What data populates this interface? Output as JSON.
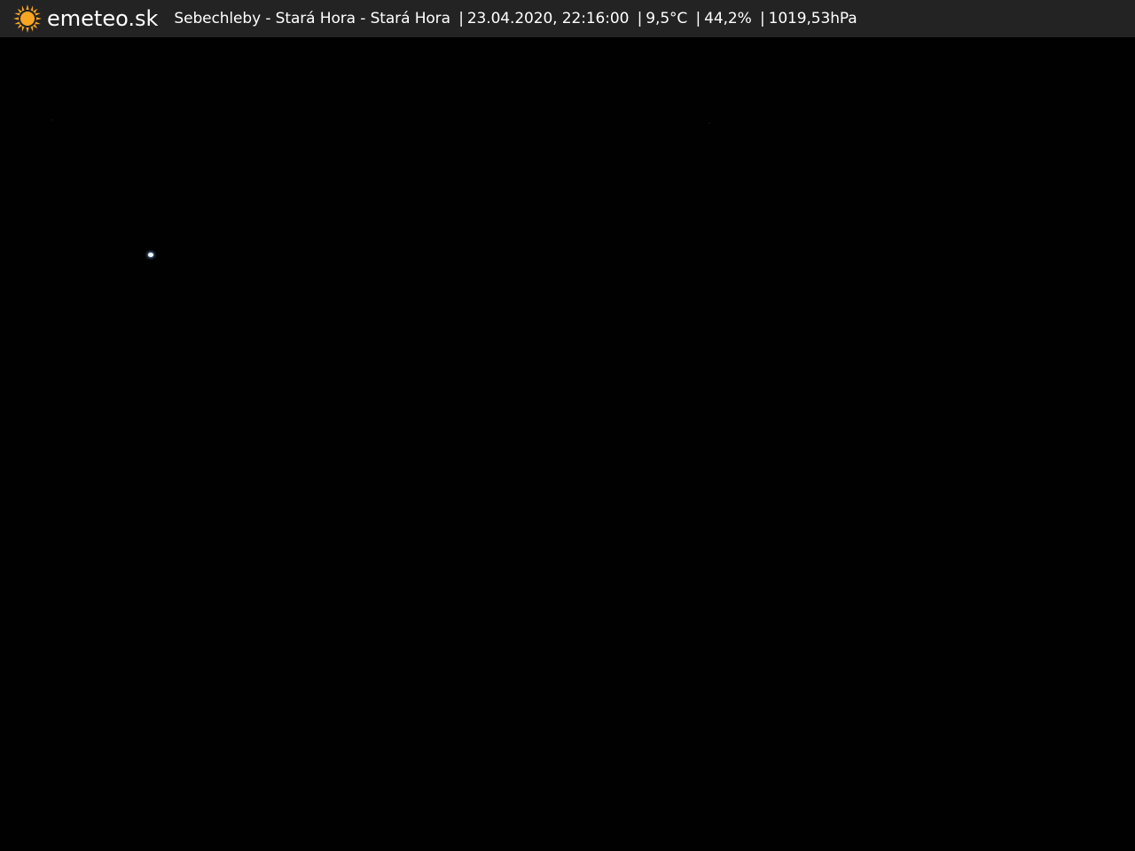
{
  "header": {
    "brand": "emeteo.sk",
    "logo_icon": "sun-icon",
    "location": "Sebechleby - Stará Hora - Stará Hora",
    "datetime": "23.04.2020, 22:16:00",
    "temperature": "9,5°C",
    "humidity": "44,2%",
    "pressure": "1019,53hPa",
    "separator": "|"
  },
  "colors": {
    "bar_background": "#232323",
    "text": "#ffffff",
    "sun": "#f6a623",
    "sky": "#010101"
  },
  "camera": {
    "scene": "night-sky"
  }
}
